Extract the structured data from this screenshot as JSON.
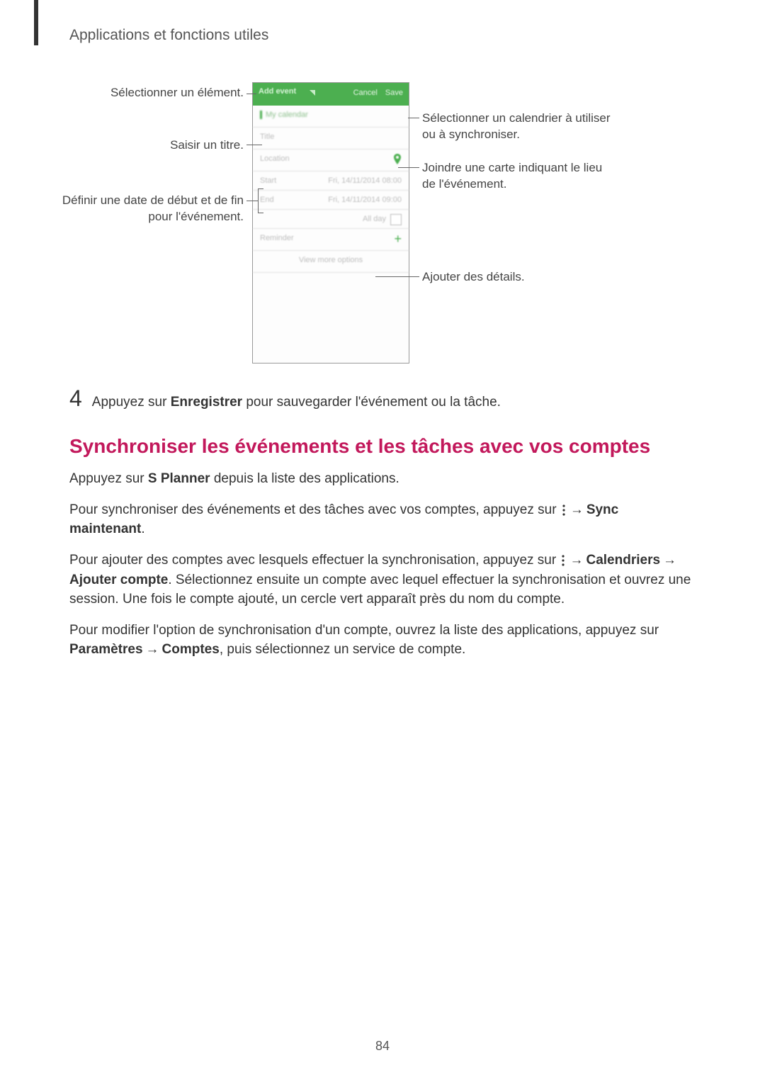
{
  "header": {
    "section": "Applications et fonctions utiles"
  },
  "figure": {
    "left_labels": {
      "select_element": "Sélectionner un élément.",
      "enter_title": "Saisir un titre.",
      "set_dates_line1": "Définir une date de début et de fin",
      "set_dates_line2": "pour l'événement."
    },
    "right_labels": {
      "select_calendar_line1": "Sélectionner un calendrier à utiliser",
      "select_calendar_line2": "ou à synchroniser.",
      "attach_map_line1": "Joindre une carte indiquant le lieu",
      "attach_map_line2": "de l'événement.",
      "add_details": "Ajouter des détails."
    },
    "phone": {
      "header_left": "Add event",
      "header_cancel": "Cancel",
      "header_save": "Save",
      "row_calendar": "My calendar",
      "row_title": "Title",
      "row_location": "Location",
      "row_start_label": "Start",
      "row_start_value": "Fri, 14/11/2014   08:00",
      "row_end_label": "End",
      "row_end_value": "Fri, 14/11/2014   09:00",
      "row_allday": "All day",
      "row_reminder": "Reminder",
      "row_more": "View more options"
    }
  },
  "step4": {
    "number": "4",
    "text_before": "Appuyez sur ",
    "text_bold": "Enregistrer",
    "text_after": " pour sauvegarder l'événement ou la tâche."
  },
  "heading": "Synchroniser les événements et les tâches avec vos comptes",
  "p1": {
    "before": "Appuyez sur ",
    "bold": "S Planner",
    "after": " depuis la liste des applications."
  },
  "p2": {
    "line_before": "Pour synchroniser des événements et des tâches avec vos comptes, appuyez sur ",
    "arrow1": "→",
    "bold1": "Sync",
    "bold2": "maintenant",
    "period": "."
  },
  "p3": {
    "before": "Pour ajouter des comptes avec lesquels effectuer la synchronisation, appuyez sur ",
    "arrow1": "→",
    "bold_calendriers": "Calendriers",
    "arrow2": "→",
    "bold_ajouter": "Ajouter compte",
    "after": ". Sélectionnez ensuite un compte avec lequel effectuer la synchronisation et ouvrez une session. Une fois le compte ajouté, un cercle vert apparaît près du nom du compte."
  },
  "p4": {
    "before": "Pour modifier l'option de synchronisation d'un compte, ouvrez la liste des applications, appuyez sur ",
    "bold_parametres": "Paramètres",
    "arrow": "→",
    "bold_comptes": "Comptes",
    "after": ", puis sélectionnez un service de compte."
  },
  "page_number": "84"
}
